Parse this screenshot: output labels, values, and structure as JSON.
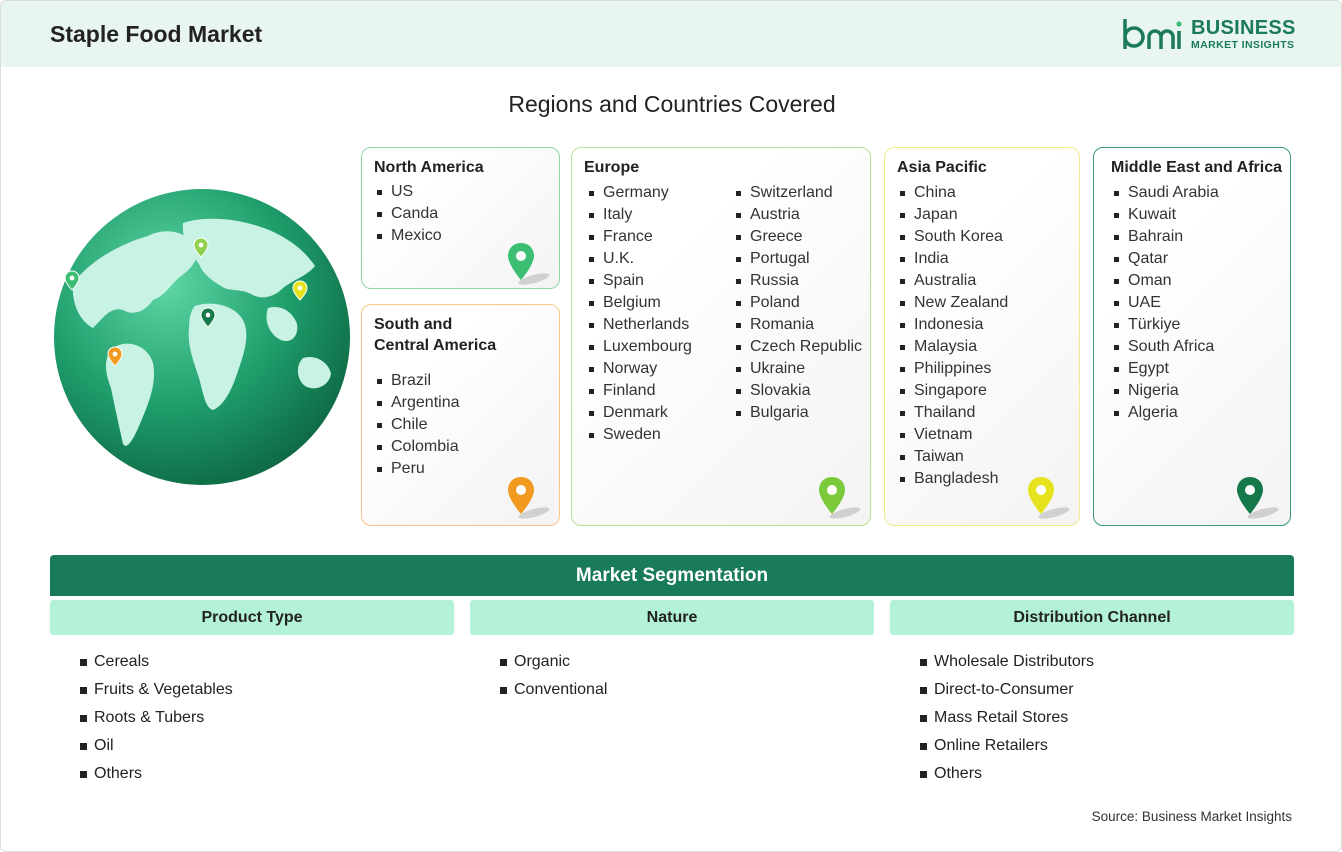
{
  "header": {
    "title": "Staple Food Market"
  },
  "logo": {
    "word1": "BUSINESS",
    "word2": "MARKET INSIGHTS",
    "color": "#1b7a5a"
  },
  "regions_title": "Regions and Countries Covered",
  "regions": {
    "north_america": {
      "title": "North America",
      "countries": [
        "US",
        "Canda",
        "Mexico"
      ],
      "pin_color": "#3dbf73"
    },
    "south_central_america": {
      "title_line1": "South and",
      "title_line2": "Central America",
      "countries": [
        "Brazil",
        "Argentina",
        "Chile",
        "Colombia",
        "Peru"
      ],
      "pin_color": "#f29a1f"
    },
    "europe": {
      "title": "Europe",
      "countries_col1": [
        "Germany",
        "Italy",
        "France",
        "U.K.",
        "Spain",
        "Belgium",
        "Netherlands",
        "Luxembourg",
        "Norway",
        "Finland",
        "Denmark",
        "Sweden"
      ],
      "countries_col2": [
        "Switzerland",
        "Austria",
        "Greece",
        "Portugal",
        "Russia",
        "Poland",
        "Romania",
        "Czech Republic",
        "Ukraine",
        "Slovakia",
        "Bulgaria"
      ],
      "pin_color": "#7cc93a"
    },
    "asia_pacific": {
      "title": "Asia Pacific",
      "countries": [
        "China",
        "Japan",
        "South Korea",
        "India",
        "Australia",
        "New Zealand",
        "Indonesia",
        "Malaysia",
        "Philippines",
        "Singapore",
        "Thailand",
        "Vietnam",
        "Taiwan",
        "Bangladesh"
      ],
      "pin_color": "#e6e21e"
    },
    "middle_east_africa": {
      "title": "Middle East and Africa",
      "countries": [
        "Saudi Arabia",
        "Kuwait",
        "Bahrain",
        "Qatar",
        "Oman",
        "UAE",
        "Türkiye",
        "South Africa",
        "Egypt",
        "Nigeria",
        "Algeria"
      ],
      "pin_color": "#15784a"
    }
  },
  "segmentation": {
    "title": "Market Segmentation",
    "product_type": {
      "title": "Product Type",
      "items": [
        "Cereals",
        "Fruits & Vegetables",
        "Roots & Tubers",
        "Oil",
        "Others"
      ]
    },
    "nature": {
      "title": "Nature",
      "items": [
        "Organic",
        "Conventional"
      ]
    },
    "distribution_channel": {
      "title": "Distribution Channel",
      "items": [
        "Wholesale Distributors",
        "Direct-to-Consumer",
        "Mass Retail Stores",
        "Online Retailers",
        "Others"
      ]
    }
  },
  "source": "Source: Business Market Insights",
  "colors": {
    "header_bg": "#e9f6ef",
    "segment_bar": "#1a7a5c",
    "segment_head": "#b3f2d6"
  }
}
